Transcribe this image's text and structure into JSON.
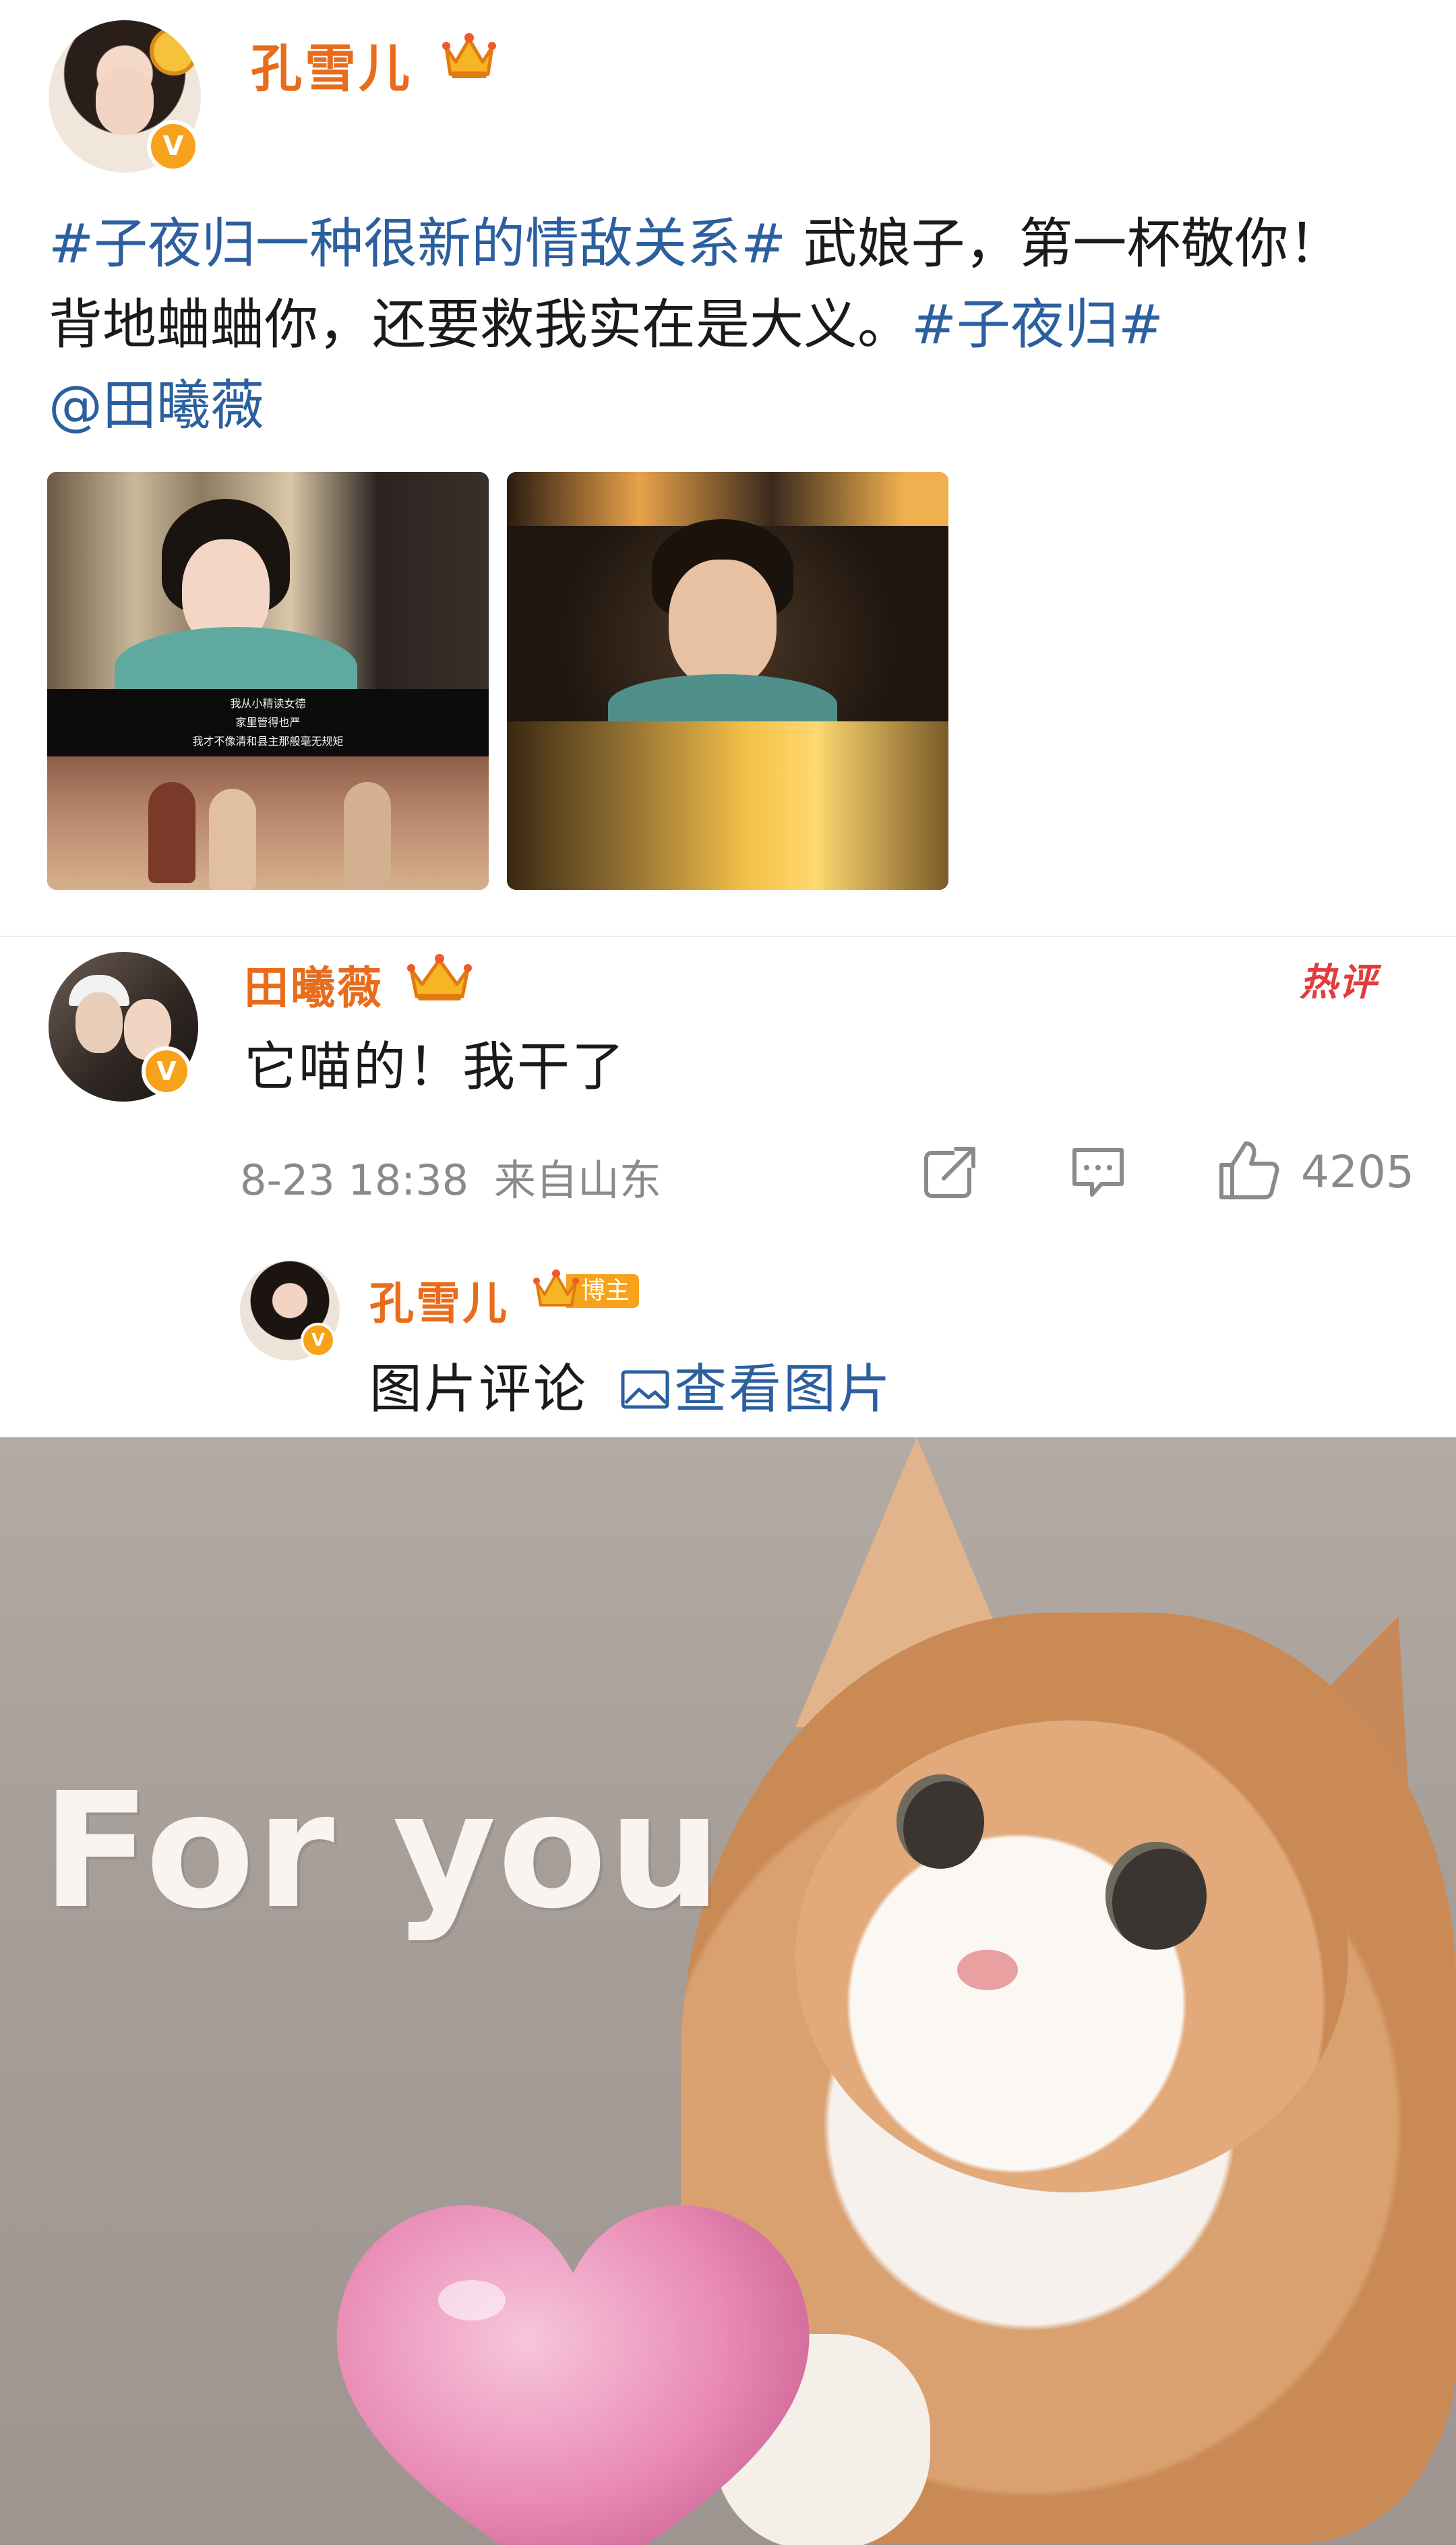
{
  "post": {
    "author": "孔雪儿",
    "verified_badge": "V",
    "text_hashtag_1": "#子夜归一种很新的情敌关系#",
    "text_main": " 武娘子，第一杯敬你！ 背地蛐蛐你，还要救我实在是大义。",
    "text_hashtag_2": "#子夜归#",
    "text_mention": "@田曦薇",
    "image1_subtitles": [
      "我从小精读女德",
      "家里管得也严",
      "我才不像清和县主那般毫无规矩"
    ]
  },
  "comment": {
    "author": "田曦薇",
    "verified_badge": "V",
    "hot_label": "热评",
    "text": "它喵的！我干了",
    "time": "8-23 18:38",
    "source": "来自山东",
    "like_count": "4205"
  },
  "reply": {
    "author": "孔雪儿",
    "verified_badge": "V",
    "role_tag": "博主",
    "text": "图片评论",
    "view_image_label": "查看图片"
  },
  "kitten_image": {
    "caption": "For you"
  },
  "colors": {
    "username_orange": "#e86c1b",
    "link_blue": "#2b5f9e",
    "hot_red": "#e23c3c",
    "meta_gray": "#8a8a8a",
    "badge_orange": "#f7a21b"
  },
  "icons": [
    "crown-icon",
    "verified-icon",
    "share-icon",
    "reply-icon",
    "like-icon",
    "picture-icon",
    "heart-icon"
  ]
}
